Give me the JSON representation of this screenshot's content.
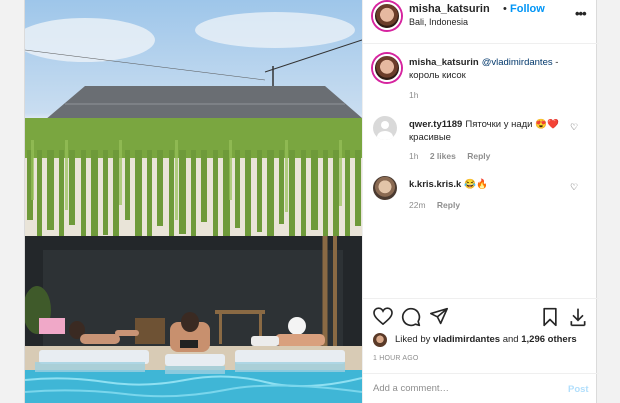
{
  "post": {
    "username": "misha_katsurin",
    "follow_dot": "•",
    "follow_label": "Follow",
    "location": "Bali, Indonesia",
    "more_glyph": "•••"
  },
  "caption": {
    "username": "misha_katsurin",
    "mention": "@vladimirdantes",
    "text": " - король кисок",
    "age": "1h"
  },
  "comments": [
    {
      "username": "qwer.ty1189",
      "text": "Пяточки у нади 😍❤️ красивые",
      "age": "1h",
      "likes": "2 likes",
      "reply": "Reply"
    },
    {
      "username": "k.kris.kris.k",
      "text": "😂🔥",
      "age": "22m",
      "reply": "Reply"
    }
  ],
  "icons": {
    "like": "heart-icon",
    "comment": "comment-icon",
    "share": "paper-plane-icon",
    "save": "bookmark-icon",
    "download": "download-icon"
  },
  "likes": {
    "prefix": "Liked by ",
    "user": "vladimirdantes",
    "middle": " and ",
    "count": "1,296 others"
  },
  "timestamp": "1 HOUR AGO",
  "add_comment": {
    "placeholder": "Add a comment…",
    "post_label": "Post"
  },
  "colors": {
    "link": "#0095f6",
    "post_disabled": "#b2dffc",
    "mention": "#00376b",
    "muted": "#8e8e8e"
  }
}
